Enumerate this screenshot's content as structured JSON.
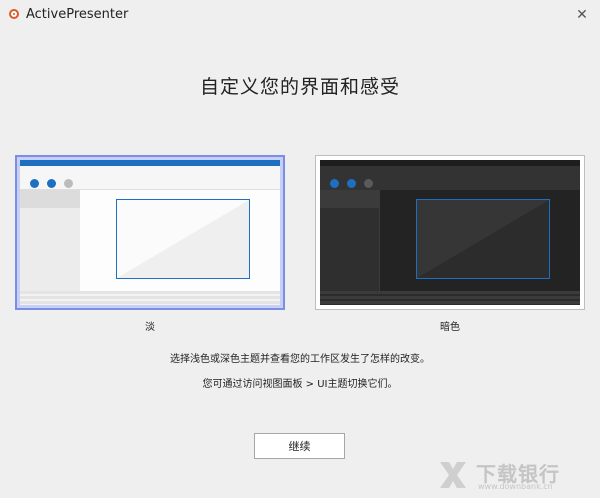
{
  "window": {
    "title": "ActivePresenter",
    "close_glyph": "✕"
  },
  "heading": "自定义您的界面和感受",
  "themes": [
    {
      "label": "淡",
      "selected": true
    },
    {
      "label": "暗色",
      "selected": false
    }
  ],
  "info": {
    "line1": "选择浅色或深色主题并查看您的工作区发生了怎样的改变。",
    "line2": "您可通过访问视图面板 > UI主题切换它们。"
  },
  "buttons": {
    "continue_label": "继续"
  },
  "watermark": {
    "text": "下载银行",
    "sub": "www.downbank.cn"
  },
  "colors": {
    "accent": "#1d6fc2",
    "selection_border": "#7a8ee6",
    "app_icon": "#e2562a"
  }
}
